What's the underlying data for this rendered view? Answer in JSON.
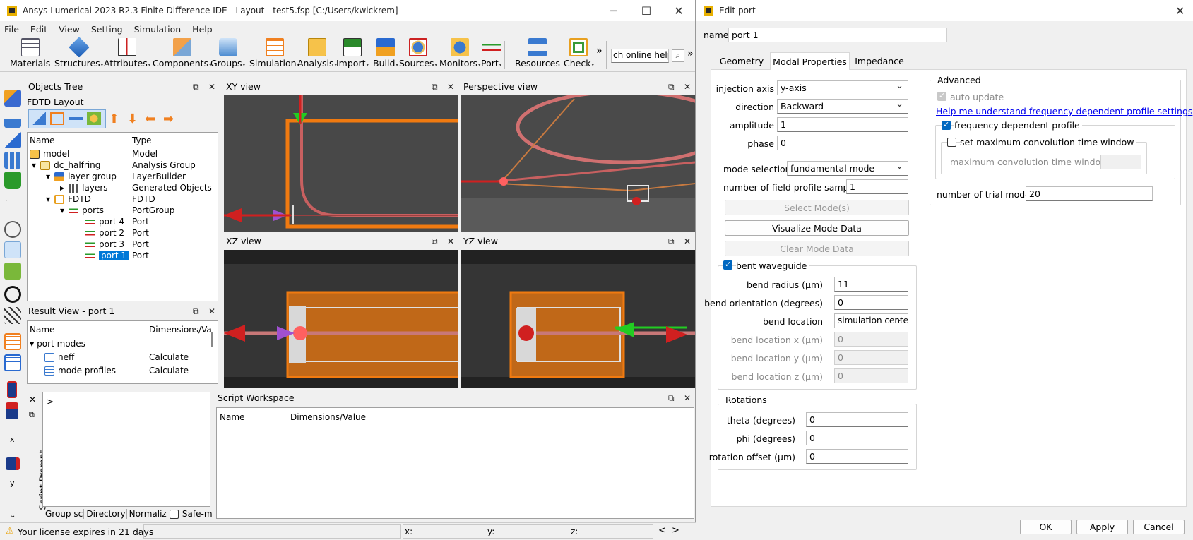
{
  "main": {
    "title": "Ansys Lumerical 2023 R2.3 Finite Difference IDE - Layout - test5.fsp [C:/Users/kwickrem]",
    "menu": [
      "File",
      "Edit",
      "View",
      "Setting",
      "Simulation",
      "Help"
    ],
    "toolbar": [
      "Materials",
      "Structures",
      "Attributes",
      "Components",
      "Groups",
      "Simulation",
      "Analysis",
      "Import",
      "Build",
      "Sources",
      "Monitors",
      "Port",
      "Resources",
      "Check"
    ],
    "more_glyph": "»",
    "search_value": "ch online help",
    "objects_tree": {
      "title": "Objects Tree",
      "subtitle": "FDTD Layout",
      "col_name": "Name",
      "col_type": "Type",
      "rows": [
        {
          "name": "model",
          "type": "Model"
        },
        {
          "name": "dc_halfring",
          "type": "Analysis Group"
        },
        {
          "name": "layer group",
          "type": "LayerBuilder"
        },
        {
          "name": "layers",
          "type": "Generated Objects"
        },
        {
          "name": "FDTD",
          "type": "FDTD"
        },
        {
          "name": "ports",
          "type": "PortGroup"
        },
        {
          "name": "port 4",
          "type": "Port"
        },
        {
          "name": "port 2",
          "type": "Port"
        },
        {
          "name": "port 3",
          "type": "Port"
        },
        {
          "name": "port 1",
          "type": "Port"
        }
      ]
    },
    "result_view": {
      "title": "Result View - port 1",
      "col_name": "Name",
      "col_value": "Dimensions/Va",
      "group": "port modes",
      "rows": [
        {
          "name": "neff",
          "value": "Calculate"
        },
        {
          "name": "mode profiles",
          "value": "Calculate"
        }
      ]
    },
    "views": {
      "xy": "XY view",
      "perspective": "Perspective view",
      "xz": "XZ view",
      "yz": "YZ view"
    },
    "script_prompt": {
      "label": "Script Prompt",
      "prompt": ">"
    },
    "script_workspace": {
      "title": "Script Workspace",
      "col_name": "Name",
      "col_value": "Dimensions/Value"
    },
    "bottom_tabs": [
      "Group sco",
      "Directory:",
      "Normalizat",
      "Safe-m"
    ],
    "status": {
      "license": "Your license expires in 21 days",
      "x": "x:",
      "y": "y:",
      "z": "z:"
    },
    "strip_labels": {
      "x": "x",
      "y": "y"
    }
  },
  "edit_port": {
    "title": "Edit port",
    "name_label": "name",
    "name_value": "port 1",
    "tabs": [
      "Geometry",
      "Modal Properties",
      "Impedance"
    ],
    "active_tab": "Modal Properties",
    "fields": {
      "injection_axis": {
        "label": "injection axis",
        "value": "y-axis"
      },
      "direction": {
        "label": "direction",
        "value": "Backward"
      },
      "amplitude": {
        "label": "amplitude",
        "value": "1"
      },
      "phase": {
        "label": "phase",
        "value": "0"
      },
      "mode_selection": {
        "label": "mode selection",
        "value": "fundamental mode"
      },
      "num_samples": {
        "label": "number of field profile samples",
        "value": "1"
      }
    },
    "buttons": {
      "select_modes": "Select Mode(s)",
      "visualize": "Visualize Mode Data",
      "clear": "Clear Mode Data",
      "ok": "OK",
      "apply": "Apply",
      "cancel": "Cancel"
    },
    "bent": {
      "label": "bent waveguide",
      "bend_radius": {
        "label": "bend radius (μm)",
        "value": "11"
      },
      "bend_orientation": {
        "label": "bend orientation (degrees)",
        "value": "0"
      },
      "bend_location": {
        "label": "bend location",
        "value": "simulation center"
      },
      "loc_x": {
        "label": "bend location x (μm)",
        "value": "0"
      },
      "loc_y": {
        "label": "bend location y (μm)",
        "value": "0"
      },
      "loc_z": {
        "label": "bend location z (μm)",
        "value": "0"
      }
    },
    "rotations": {
      "title": "Rotations",
      "theta": {
        "label": "theta (degrees)",
        "value": "0"
      },
      "phi": {
        "label": "phi (degrees)",
        "value": "0"
      },
      "offset": {
        "label": "rotation offset (μm)",
        "value": "0"
      }
    },
    "advanced": {
      "title": "Advanced",
      "auto_update": "auto update",
      "help_link": "Help me understand frequency dependent profile settings",
      "freq_profile": "frequency dependent profile",
      "set_max_conv": "set maximum convolution time window",
      "max_conv_label": "maximum convolution time window (fs)",
      "trial_modes_label": "number of trial modes",
      "trial_modes_value": "20"
    }
  }
}
